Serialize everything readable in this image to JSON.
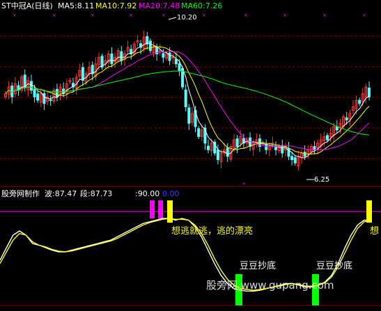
{
  "colors": {
    "background": "#000000",
    "grid": "#8b0000",
    "up_candle": "#ff3232",
    "down_candle": "#54ffff",
    "ma5": "#ffffff",
    "ma10": "#ffff00",
    "ma20": "#ff00ff",
    "ma60": "#00ff00",
    "marker": "#ff00ff",
    "osc_white": "#ffffff",
    "osc_yellow": "#ffff00",
    "level_line": "#ff00ff",
    "bar_magenta": "#ff00ff",
    "bar_yellow": "#ffff00",
    "bar_green": "#00ff00",
    "watermark": "#ffffff"
  },
  "top_panel": {
    "title": "ST中冠A(日线)",
    "ma_labels": [
      {
        "text": "MA5:8.11",
        "color": "#ffffff"
      },
      {
        "text": "MA10:7.92",
        "color": "#ffff00"
      },
      {
        "text": "MA20:7.48",
        "color": "#ff00ff"
      },
      {
        "text": "MA60:7.26",
        "color": "#00ff00"
      }
    ],
    "high_label": "10.20",
    "low_label": "6.25"
  },
  "bottom_panel": {
    "title": "股旁网制作",
    "bo_label": "波:87.47",
    "duan_label": "段:87.73",
    "level_label": ":90.00",
    "zero_label": "0.00",
    "sell_text": "想逃就逃，逃的漂亮",
    "sell_text_short": "想",
    "buy_text_1": "豆豆抄底",
    "buy_text_2": "豆豆抄底",
    "watermark": "股旁网 www.gupang.com"
  },
  "chart_data": [
    {
      "type": "candlestick",
      "title": "ST中冠A(日线)",
      "ylim": [
        5.8,
        10.6
      ],
      "high_marker": 10.2,
      "low_marker": 6.25,
      "closes": [
        8.4,
        8.6,
        8.3,
        8.7,
        8.5,
        8.9,
        8.6,
        8.8,
        8.5,
        8.3,
        8.2,
        8.4,
        8.1,
        8.3,
        8.2,
        8.5,
        8.3,
        8.6,
        8.4,
        8.7,
        8.8,
        8.6,
        8.9,
        9.1,
        8.8,
        9.0,
        9.2,
        9.0,
        9.3,
        9.5,
        9.2,
        9.4,
        9.6,
        9.3,
        9.5,
        9.7,
        9.4,
        9.6,
        9.8,
        9.6,
        9.9,
        10.0,
        9.8,
        10.1,
        9.9,
        9.7,
        9.8,
        9.6,
        9.7,
        9.5,
        9.6,
        9.4,
        9.5,
        9.3,
        9.1,
        8.6,
        8.0,
        7.5,
        7.8,
        7.4,
        7.1,
        7.3,
        6.9,
        6.7,
        6.9,
        6.6,
        6.4,
        6.6,
        6.7,
        6.5,
        6.8,
        7.0,
        6.8,
        7.1,
        6.9,
        7.0,
        6.8,
        6.9,
        7.0,
        6.8,
        6.9,
        6.7,
        6.8,
        6.9,
        6.7,
        6.8,
        6.6,
        6.8,
        6.5,
        6.4,
        6.3,
        6.5,
        6.6,
        6.5,
        6.7,
        6.8,
        6.7,
        6.9,
        7.0,
        7.1,
        7.0,
        7.2,
        7.4,
        7.3,
        7.5,
        7.7,
        7.6,
        7.8,
        8.0,
        8.2,
        8.1,
        8.4,
        8.6,
        8.3
      ],
      "ma_periods": [
        5,
        10,
        20,
        60
      ]
    },
    {
      "type": "line",
      "title": "股旁网制作",
      "ylim": [
        -10,
        110
      ],
      "reference_levels": [
        90,
        0
      ],
      "series": [
        {
          "name": "波",
          "color": "#ffffff",
          "values": [
            40,
            55,
            70,
            75,
            70,
            60,
            58,
            55,
            52,
            50,
            50,
            52,
            54,
            56,
            58,
            60,
            62,
            64,
            68,
            72,
            76,
            80,
            84,
            86,
            88,
            90,
            90,
            88,
            90,
            88,
            80,
            68,
            52,
            36,
            22,
            12,
            6,
            4,
            3,
            3,
            4,
            6,
            8,
            10,
            12,
            12,
            10,
            8,
            8,
            10,
            14,
            22,
            36,
            54,
            70,
            82,
            88,
            87.47
          ]
        },
        {
          "name": "段",
          "color": "#ffff00",
          "values": [
            36,
            50,
            64,
            72,
            70,
            62,
            58,
            56,
            53,
            51,
            50,
            51,
            53,
            55,
            57,
            59,
            61,
            63,
            66,
            70,
            74,
            78,
            82,
            85,
            87,
            89,
            90,
            89,
            89,
            88,
            82,
            72,
            58,
            42,
            28,
            17,
            10,
            6,
            5,
            4,
            5,
            6,
            8,
            9,
            11,
            12,
            11,
            9,
            9,
            10,
            13,
            20,
            32,
            48,
            64,
            78,
            86,
            87.73
          ]
        }
      ],
      "signal_bars": [
        {
          "color": "#ff00ff",
          "label": "magenta"
        },
        {
          "color": "#ffff00",
          "label": "sell"
        },
        {
          "color": "#00ff00",
          "label": "buy"
        }
      ]
    }
  ]
}
